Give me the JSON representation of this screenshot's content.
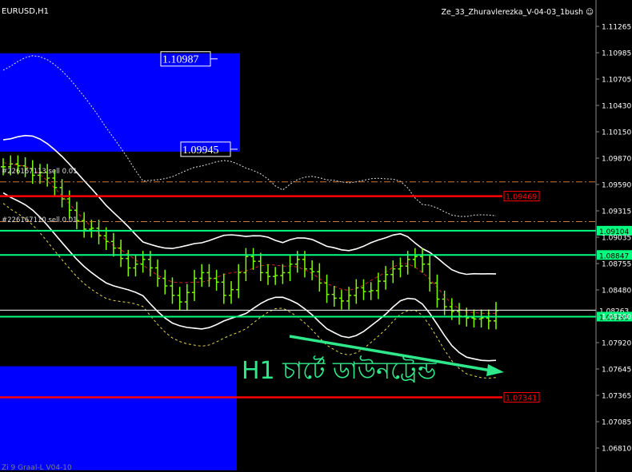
{
  "header": {
    "symbol": "EURUSD,H1",
    "expert": "Ze_33_Zhuravlerezka_V-04-03_1bush",
    "expert_icon": "smiley-icon",
    "indicator": "Zi 9 Graal-L V04-10"
  },
  "colors": {
    "background": "#000000",
    "price_bars": "#7CFC00",
    "bollinger": "#FFFFFF",
    "zone": "#0000FF",
    "support_line": "#00FF7F",
    "resistance_line": "#FF0000",
    "annotation": "#2EE88A"
  },
  "chart_data": {
    "type": "line",
    "series": [],
    "ylim": [
      1.0657,
      1.1139
    ],
    "yticks": [
      "1.11265",
      "1.10985",
      "1.10705",
      "1.10430",
      "1.10150",
      "1.09870",
      "1.09590",
      "1.09315",
      "1.09035",
      "1.08755",
      "1.08480",
      "1.08200",
      "1.07920",
      "1.07645",
      "1.07365",
      "1.07085",
      "1.06810"
    ],
    "y_start_tick": 1.11265,
    "y_tick_step": 0.0027875,
    "price_bars_close": [
      1.0978,
      1.0981,
      1.0979,
      1.0976,
      1.0969,
      1.0972,
      1.0966,
      1.0956,
      1.0944,
      1.0932,
      1.0921,
      1.0912,
      1.0913,
      1.0905,
      1.0899,
      1.0892,
      1.0881,
      1.0871,
      1.0875,
      1.088,
      1.0871,
      1.086,
      1.0852,
      1.0842,
      1.0835,
      1.0845,
      1.086,
      1.0866,
      1.086,
      1.0856,
      1.0842,
      1.0848,
      1.0866,
      1.0883,
      1.0878,
      1.0866,
      1.0862,
      1.0863,
      1.0866,
      1.0875,
      1.088,
      1.087,
      1.0867,
      1.0855,
      1.0843,
      1.0839,
      1.0836,
      1.0842,
      1.085,
      1.0846,
      1.0847,
      1.0857,
      1.0864,
      1.087,
      1.0873,
      1.088,
      1.0883,
      1.0875,
      1.0855,
      1.0838,
      1.083,
      1.0825,
      1.082,
      1.0818,
      1.0817,
      1.0818,
      1.0815,
      1.0826
    ],
    "levels": [
      {
        "label": "1.09469",
        "value": 1.09469,
        "color": "#FF0000"
      },
      {
        "label": "1.09104",
        "value": 1.09104,
        "color": "#00FF7F"
      },
      {
        "label": "1.08847",
        "value": 1.08847,
        "color": "#00FF7F"
      },
      {
        "label": "1.08263",
        "value": 1.08263,
        "color": "#FFFFFF"
      },
      {
        "label": "1.08195",
        "value": 1.08195,
        "color": "#00FF7F"
      },
      {
        "label": "1.07341",
        "value": 1.07341,
        "color": "#FF0000"
      }
    ],
    "zones": [
      {
        "top": 1.1098,
        "bottom": 1.0994,
        "label_top": "1.10987",
        "label_bottom": "1.09945"
      },
      {
        "top": 1.0767,
        "bottom": 1.0657
      }
    ],
    "annotations": [
      {
        "text": "H1 চার্টে ডাউনট্রেন্ড"
      }
    ],
    "order_labels": [
      "#226167113 sell 0.01",
      "#226167110 sell 0.01"
    ],
    "grid": false
  }
}
